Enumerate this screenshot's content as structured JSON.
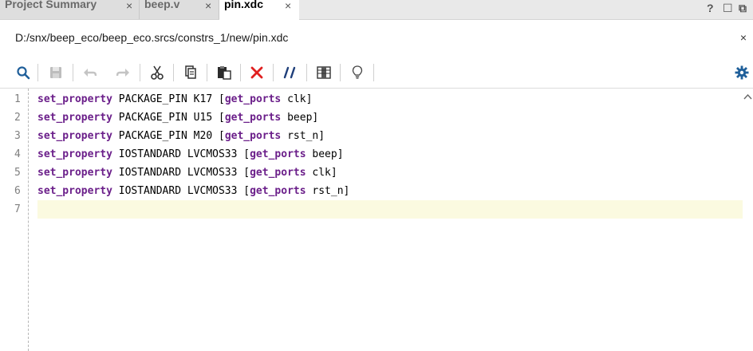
{
  "tabs": [
    {
      "label": "Project Summary",
      "close": "×",
      "active": false
    },
    {
      "label": "beep.v",
      "close": "×",
      "active": false
    },
    {
      "label": "pin.xdc",
      "close": "×",
      "active": true
    }
  ],
  "window_controls": {
    "help": "?",
    "restore": "☐",
    "float": "⧉"
  },
  "file": {
    "path": "D:/snx/beep_eco/beep_eco.srcs/constrs_1/new/pin.xdc",
    "close": "×"
  },
  "toolbar": {
    "icons": [
      "search-icon",
      "save-icon",
      "undo-icon",
      "redo-icon",
      "cut-icon",
      "copy-icon",
      "paste-icon",
      "delete-icon",
      "comment-icon",
      "column-select-icon",
      "lightbulb-icon",
      "gear-icon"
    ]
  },
  "editor": {
    "line_numbers": [
      "1",
      "2",
      "3",
      "4",
      "5",
      "6",
      "7"
    ],
    "lines": [
      {
        "kw": "set_property",
        "a": " PACKAGE_PIN K17 [",
        "kw2": "get_ports",
        "b": " clk]"
      },
      {
        "kw": "set_property",
        "a": " PACKAGE_PIN U15 [",
        "kw2": "get_ports",
        "b": " beep]"
      },
      {
        "kw": "set_property",
        "a": " PACKAGE_PIN M20 [",
        "kw2": "get_ports",
        "b": " rst_n]"
      },
      {
        "kw": "set_property",
        "a": " IOSTANDARD LVCMOS33 [",
        "kw2": "get_ports",
        "b": " beep]"
      },
      {
        "kw": "set_property",
        "a": " IOSTANDARD LVCMOS33 [",
        "kw2": "get_ports",
        "b": " clk]"
      },
      {
        "kw": "set_property",
        "a": " IOSTANDARD LVCMOS33 [",
        "kw2": "get_ports",
        "b": " rst_n]"
      }
    ],
    "current_line": 7
  },
  "colors": {
    "keyword": "#6b1f8a",
    "current_line_bg": "#fbfae0",
    "delete_red": "#e02020",
    "accent_blue": "#1f5f9a"
  }
}
